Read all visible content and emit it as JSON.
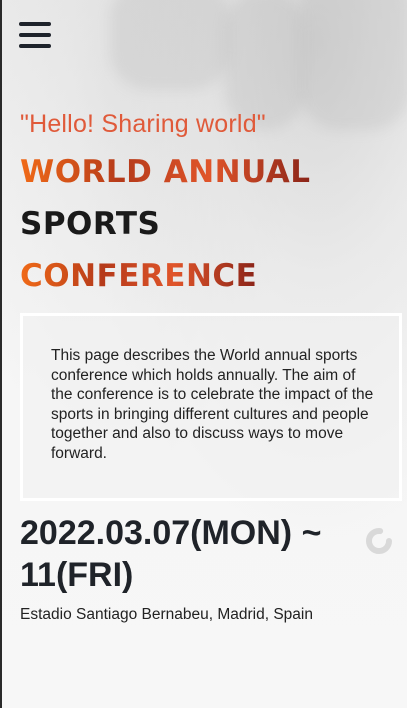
{
  "header": {
    "menu_icon": "hamburger-menu-icon"
  },
  "hero": {
    "greeting": "\"Hello! Sharing world\"",
    "title_lines": [
      "WORLD ANNUAL",
      "SPORTS",
      "CONFERENCE"
    ]
  },
  "description": {
    "text": "This page describes the World annual sports conference which holds annually. The aim of the conference is to celebrate the impact of the sports in bringing different cultures and people together and also to discuss ways to move forward."
  },
  "event": {
    "date": "2022.03.07(MON) ~ 11(FRI)",
    "venue": "Estadio Santiago Bernabeu, Madrid, Spain"
  },
  "colors": {
    "accent": "#e05a3a",
    "text_dark": "#1f2329"
  },
  "icons": {
    "loader": "loading-spinner-icon"
  }
}
